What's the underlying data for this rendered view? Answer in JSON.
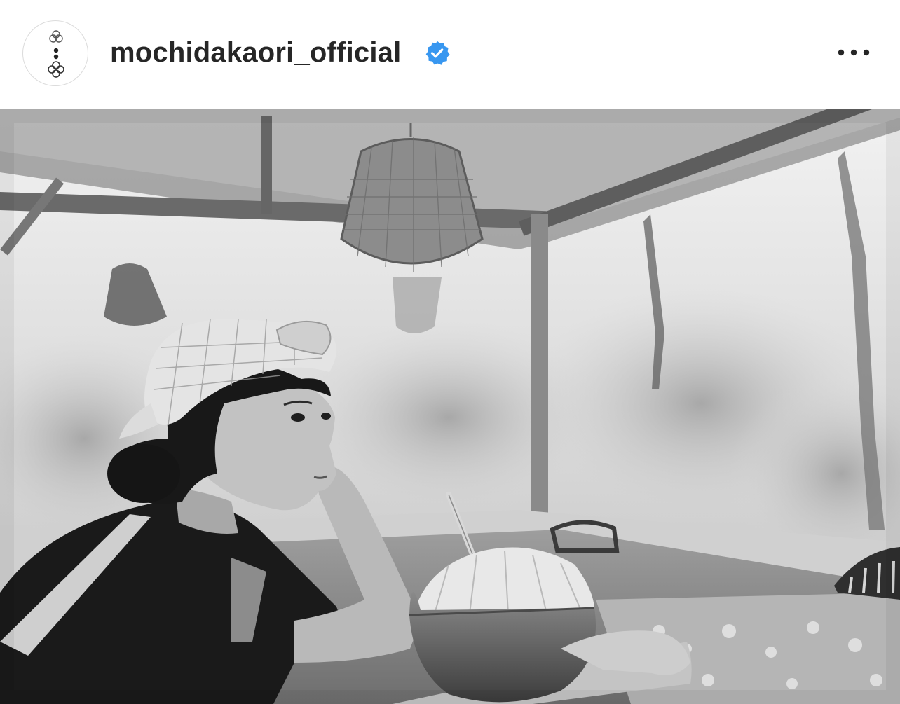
{
  "post": {
    "author": {
      "username": "mochidakaori_official",
      "verified": true,
      "avatar_icon": "logo-avatar-icon",
      "verified_icon": "verified-badge-icon"
    },
    "header": {
      "more_icon": "more-options-icon"
    },
    "photo": {
      "style": "black-and-white"
    }
  },
  "colors": {
    "text": "#262626",
    "verified_badge": "#3897f0",
    "avatar_border": "#dbdbdb",
    "background": "#ffffff"
  }
}
